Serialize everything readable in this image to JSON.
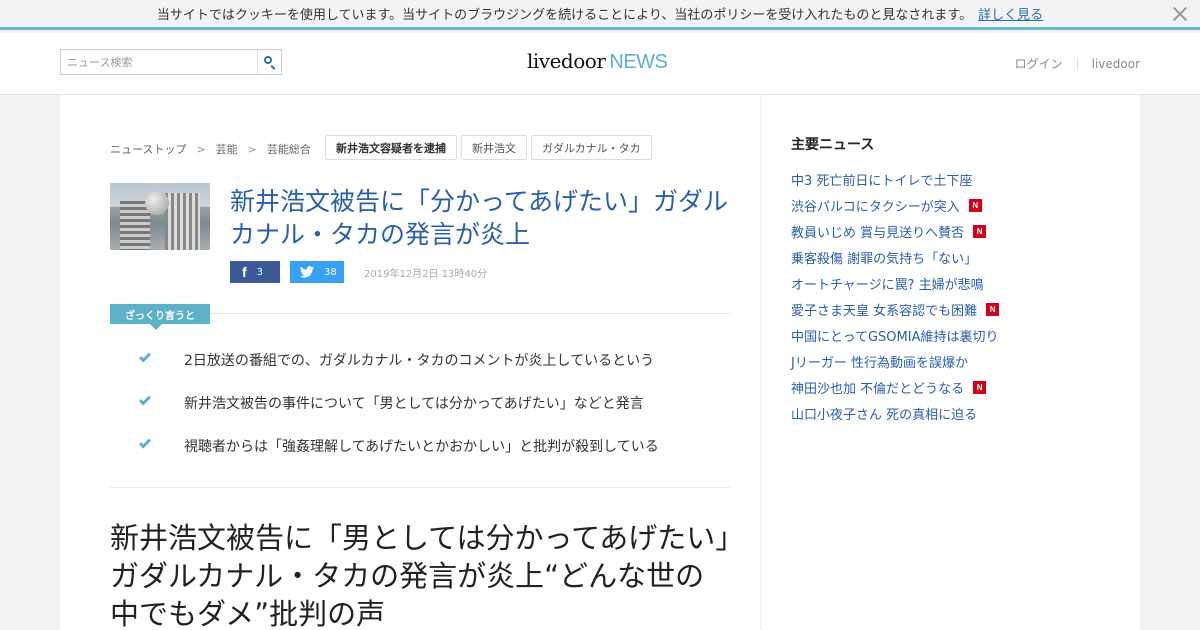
{
  "cookie_bar": {
    "message": "当サイトではクッキーを使用しています。当サイトのブラウジングを続けることにより、当社のポリシーを受け入れたものと見なされます。",
    "link": "詳しく見る"
  },
  "header": {
    "search_placeholder": "ニュース検索",
    "logo_main": "livedoor",
    "logo_news": "NEWS",
    "nav": [
      "ログイン",
      "livedoor"
    ]
  },
  "breadcrumb": [
    "ニューストップ",
    "芸能",
    "芸能総合"
  ],
  "breadcrumb_separator": ">",
  "tags": [
    "新井浩文容疑者を逮捕",
    "新井浩文",
    "ガダルカナル・タカ"
  ],
  "article": {
    "headline": "新井浩文被告に「分かってあげたい」ガダルカナル・タカの発言が炎上",
    "facebook_count": "3",
    "twitter_count": "38",
    "date": "2019年12月2日 13時40分",
    "summary_label": "ざっくり言うと",
    "summary": [
      "2日放送の番組での、ガダルカナル・タカのコメントが炎上しているという",
      "新井浩文被告の事件について「男としては分かってあげたい」などと発言",
      "視聴者からは「強姦理解してあげたいとかおかしい」と批判が殺到している"
    ],
    "body_title": "新井浩文被告に「男としては分かってあげたい」ガダルカナル・タカの発言が炎上“どんな世の中でもダメ”批判の声"
  },
  "sidebar": {
    "title": "主要ニュース",
    "news": [
      {
        "text": "中3 死亡前日にトイレで土下座",
        "new": false
      },
      {
        "text": "渋谷パルコにタクシーが突入",
        "new": true
      },
      {
        "text": "教員いじめ 賞与見送りへ賛否",
        "new": true
      },
      {
        "text": "乗客殺傷 謝罪の気持ち「ない」",
        "new": false
      },
      {
        "text": "オートチャージに罠? 主婦が悲鳴",
        "new": false
      },
      {
        "text": "愛子さま天皇 女系容認でも困難",
        "new": true
      },
      {
        "text": "中国にとってGSOMIA維持は裏切り",
        "new": false
      },
      {
        "text": "Jリーガー 性行為動画を誤爆か",
        "new": false
      },
      {
        "text": "神田沙也加 不倫だとどうなる",
        "new": true
      },
      {
        "text": "山口小夜子さん 死の真相に迫る",
        "new": false
      }
    ],
    "new_badge": "N"
  },
  "colors": {
    "accent": "#5fb1c9",
    "link": "#2a5ea8",
    "facebook": "#3b5998",
    "twitter": "#38a1f3",
    "new_badge": "#d0021b"
  }
}
